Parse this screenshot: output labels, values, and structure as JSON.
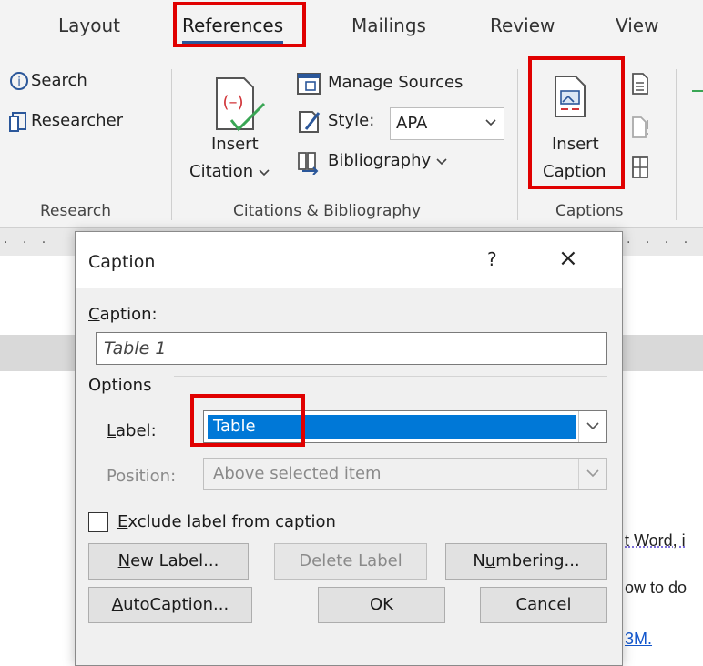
{
  "ribbon": {
    "tabs": [
      {
        "label": "Layout"
      },
      {
        "label": "References"
      },
      {
        "label": "Mailings"
      },
      {
        "label": "Review"
      },
      {
        "label": "View"
      }
    ],
    "research": {
      "search": "Search",
      "researcher": "Researcher",
      "group": "Research"
    },
    "citations": {
      "insert_line1": "Insert",
      "insert_line2": "Citation",
      "manage_sources": "Manage Sources",
      "style_label": "Style:",
      "style_value": "APA",
      "bibliography": "Bibliography",
      "group": "Citations & Bibliography"
    },
    "captions": {
      "insert_line1": "Insert",
      "insert_line2": "Caption",
      "group": "Captions"
    }
  },
  "doc": {
    "line1": "t Word, i",
    "line2": "ow to do",
    "link": "3M."
  },
  "dialog": {
    "title": "Caption",
    "help": "?",
    "close": "×",
    "caption_label_u": "C",
    "caption_label_rest": "aption:",
    "caption_value": "Table 1",
    "options": "Options",
    "label_u": "L",
    "label_rest": "abel:",
    "label_value": "Table",
    "position_label": "Position:",
    "position_value": "Above selected item",
    "exclude_u": "E",
    "exclude_rest": "xclude label from caption",
    "new_label_u": "N",
    "new_label_rest": "ew Label...",
    "delete_label": "Delete Label",
    "numbering_pre": "N",
    "numbering_u": "u",
    "numbering_rest": "mbering...",
    "autocaption_u": "A",
    "autocaption_rest": "utoCaption...",
    "ok": "OK",
    "cancel": "Cancel"
  },
  "colors": {
    "highlight_box": "#e00000",
    "selection": "#0078d7",
    "accent": "#2b579a"
  }
}
